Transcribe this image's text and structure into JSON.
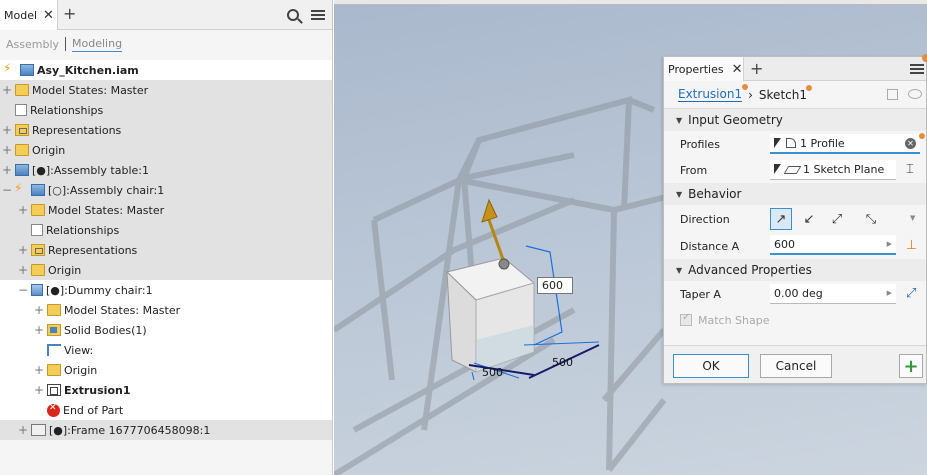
{
  "browser": {
    "tab_label": "Model",
    "mode_assembly": "Assembly",
    "mode_modeling": "Modeling",
    "tree": [
      {
        "label": "Asy_Kitchen.iam",
        "bold": true
      },
      {
        "label": "Model States: Master"
      },
      {
        "label": "Relationships"
      },
      {
        "label": "Representations"
      },
      {
        "label": "Origin"
      },
      {
        "label": "[●]:Assembly table:1"
      },
      {
        "label": "[○]:Assembly chair:1"
      },
      {
        "label": "Model States: Master"
      },
      {
        "label": "Relationships"
      },
      {
        "label": "Representations"
      },
      {
        "label": "Origin"
      },
      {
        "label": "[●]:Dummy chair:1"
      },
      {
        "label": "Model States: Master"
      },
      {
        "label": "Solid Bodies(1)"
      },
      {
        "label": "View:"
      },
      {
        "label": "Origin"
      },
      {
        "label": "Extrusion1",
        "bold": true
      },
      {
        "label": "End of Part"
      },
      {
        "label": "[●]:Frame 1677706458098:1"
      }
    ]
  },
  "viewport": {
    "dim_height": "600",
    "dim_width": "500",
    "dim_depth": "500"
  },
  "properties": {
    "tab_label": "Properties",
    "crumb_feature": "Extrusion1",
    "crumb_sketch": "Sketch1",
    "sections": {
      "input_geometry": "Input Geometry",
      "behavior": "Behavior",
      "advanced": "Advanced Properties"
    },
    "fields": {
      "profiles_label": "Profiles",
      "profiles_value": "1 Profile",
      "from_label": "From",
      "from_value": "1 Sketch Plane",
      "direction_label": "Direction",
      "distance_label": "Distance A",
      "distance_value": "600",
      "taper_label": "Taper A",
      "taper_value": "0.00 deg",
      "match_shape": "Match Shape"
    },
    "ok_label": "OK",
    "cancel_label": "Cancel"
  },
  "colors": {
    "accent": "#3a8fd0",
    "modified_dot": "#e78b3c",
    "viewport_top": "#a9b8cc"
  }
}
